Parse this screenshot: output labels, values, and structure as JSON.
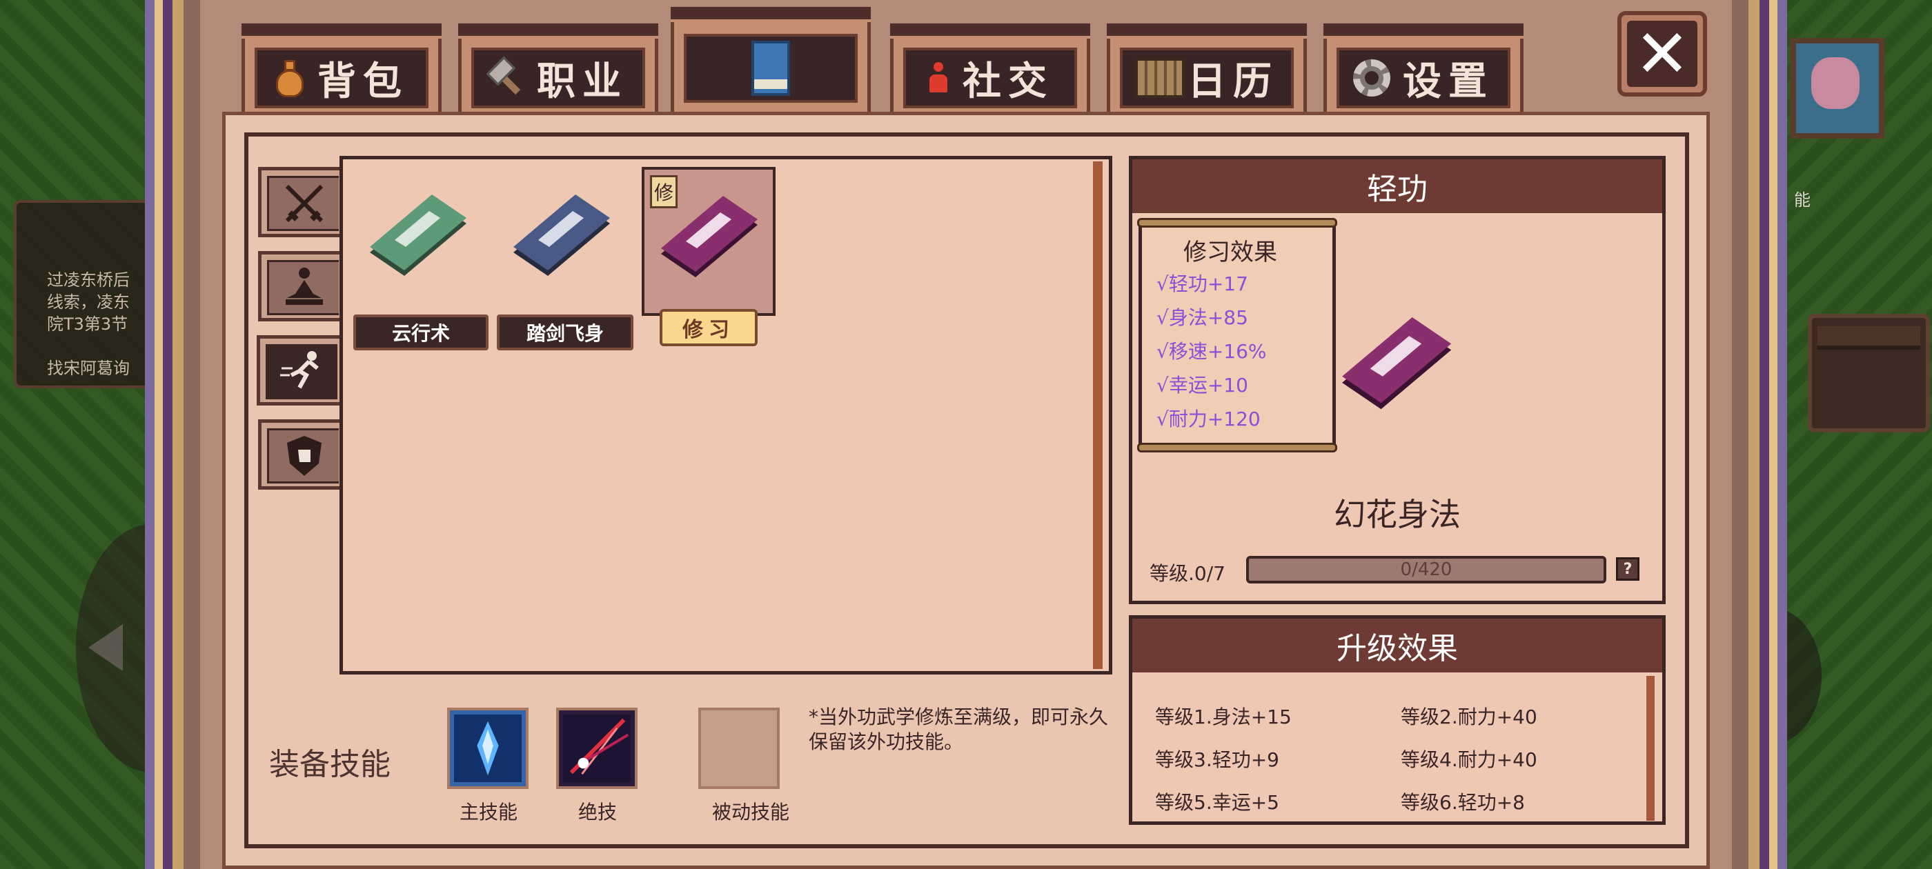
{
  "background": {
    "quest_text": "过凌东桥后\n线索，凌东\n院T3第3节\n\n找宋阿葛询",
    "side_label": "能"
  },
  "tabs": [
    {
      "label": "背包",
      "icon": "bag-icon"
    },
    {
      "label": "职业",
      "icon": "hammer-icon"
    },
    {
      "label": "",
      "icon": "book-icon",
      "active": true
    },
    {
      "label": "社交",
      "icon": "person-icon"
    },
    {
      "label": "日历",
      "icon": "calendar-icon"
    },
    {
      "label": "设置",
      "icon": "gear-icon"
    }
  ],
  "close_label": "✕",
  "categories": [
    {
      "name": "swords",
      "icon": "crossed-swords-icon"
    },
    {
      "name": "meditation",
      "icon": "meditation-icon"
    },
    {
      "name": "movement",
      "icon": "running-icon",
      "active": true
    },
    {
      "name": "defense",
      "icon": "shield-fist-icon"
    }
  ],
  "skills": [
    {
      "name": "云行术",
      "color": "#5c9a78"
    },
    {
      "name": "踏剑飞身",
      "color": "#4a5a86"
    },
    {
      "name": "修习",
      "color": "#8a2f6e",
      "selected": true,
      "badge": "修"
    }
  ],
  "equip": {
    "title": "装备技能",
    "slots": [
      {
        "label": "主技能",
        "icon": "blue-crystal-icon"
      },
      {
        "label": "绝技",
        "icon": "red-slash-icon"
      },
      {
        "label": "被动技能",
        "icon": "empty-slot"
      }
    ],
    "note": "*当外功武学修炼至满级，即可永久保留该外功技能。"
  },
  "detail": {
    "header": "轻功",
    "effects_title": "修习效果",
    "effects": [
      "√轻功+17",
      "√身法+85",
      "√移速+16%",
      "√幸运+10",
      "√耐力+120"
    ],
    "skill_name": "幻花身法",
    "level_label": "等级.0/7",
    "xp_text": "0/420",
    "xp_progress": 0,
    "help_label": "?"
  },
  "upgrade": {
    "header": "升级效果",
    "items": [
      "等级1.身法+15",
      "等级2.耐力+40",
      "等级3.轻功+9",
      "等级4.耐力+40",
      "等级5.幸运+5",
      "等级6.轻功+8"
    ]
  },
  "colors": {
    "accent": "#6e3b34",
    "effect_text": "#8a4fd8",
    "study_button": "#fcd88e"
  }
}
